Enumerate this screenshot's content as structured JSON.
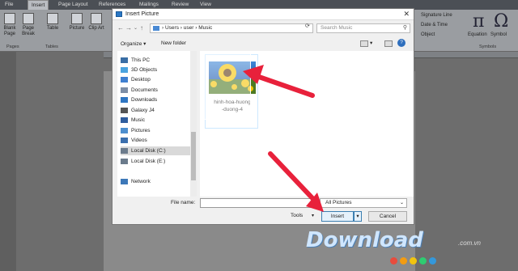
{
  "ribbon": {
    "tabs": [
      "File",
      "Insert",
      "Page Layout",
      "References",
      "Mailings",
      "Review",
      "View"
    ],
    "active_tab": "Insert",
    "buttons": [
      "Blank Page",
      "Page Break",
      "Table",
      "Picture",
      "Clip Art"
    ],
    "groups": [
      "Pages",
      "Tables"
    ],
    "right_items": [
      "Signature Line",
      "Date & Time",
      "Object"
    ],
    "symbols": {
      "equation": "Equation",
      "symbol": "Symbol",
      "group": "Symbols",
      "pi": "π",
      "omega": "Ω"
    }
  },
  "dialog": {
    "title": "Insert Picture",
    "path": [
      "Users",
      "user",
      "Music"
    ],
    "search_placeholder": "Search Music",
    "toolbar": {
      "organize": "Organize",
      "new_folder": "New folder"
    },
    "nav_items": [
      {
        "label": "This PC",
        "icon": "computer-icon",
        "color": "#3a6ea5"
      },
      {
        "label": "3D Objects",
        "icon": "cube-icon",
        "color": "#4aa3df"
      },
      {
        "label": "Desktop",
        "icon": "desktop-icon",
        "color": "#3f7fd0"
      },
      {
        "label": "Documents",
        "icon": "document-icon",
        "color": "#7d8ea6"
      },
      {
        "label": "Downloads",
        "icon": "download-icon",
        "color": "#2f76c2"
      },
      {
        "label": "Galaxy J4",
        "icon": "phone-icon",
        "color": "#555555"
      },
      {
        "label": "Music",
        "icon": "music-icon",
        "color": "#2f5d9e"
      },
      {
        "label": "Pictures",
        "icon": "pictures-icon",
        "color": "#4d8fcf"
      },
      {
        "label": "Videos",
        "icon": "video-icon",
        "color": "#3b6fae"
      },
      {
        "label": "Local Disk (C:)",
        "icon": "disk-icon",
        "color": "#6b7b8c"
      },
      {
        "label": "Local Disk (E:)",
        "icon": "disk-icon",
        "color": "#6b7b8c"
      },
      {
        "label": "Network",
        "icon": "network-icon",
        "color": "#3d78b8"
      }
    ],
    "selected_nav": "Local Disk (C:)",
    "file": {
      "name_line1": "hinh-hoa-huong",
      "name_line2": "-duong-4"
    },
    "file_name_label": "File name:",
    "file_name_value": "",
    "filter": "All Pictures",
    "tools_label": "Tools",
    "insert_label": "Insert",
    "cancel_label": "Cancel"
  },
  "watermark": {
    "text": "Download",
    "suffix": ".com.vn"
  },
  "colors": {
    "arrow": "#e8213b",
    "accent": "#3c7fb1",
    "dots": [
      "#e84c3d",
      "#f39c12",
      "#f1c40f",
      "#2ecc71",
      "#3498db"
    ]
  }
}
